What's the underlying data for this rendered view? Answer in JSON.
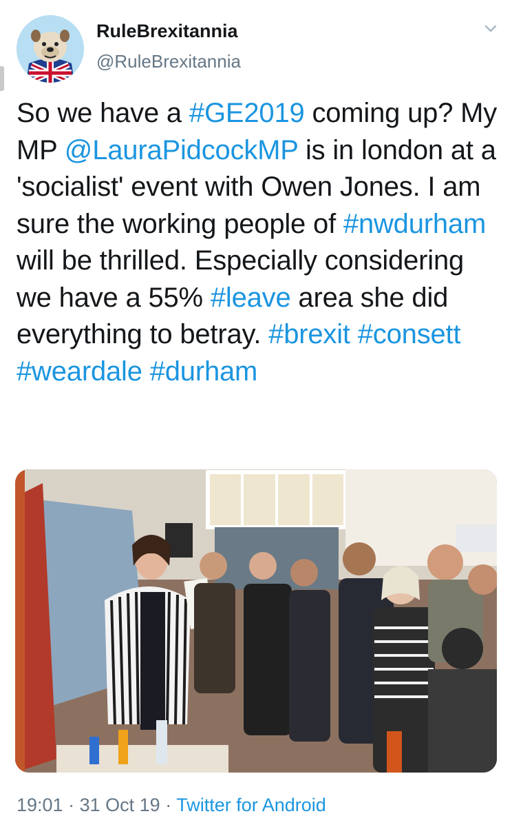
{
  "author": {
    "display_name": "RuleBrexitannia",
    "handle": "@RuleBrexitannia",
    "avatar_icon": "bulldog-union-jack-avatar"
  },
  "tweet": {
    "segments": [
      {
        "type": "text",
        "value": "So we have a "
      },
      {
        "type": "tag",
        "value": "#GE2019"
      },
      {
        "type": "text",
        "value": " coming up? My MP "
      },
      {
        "type": "mention",
        "value": "@LauraPidcockMP"
      },
      {
        "type": "text",
        "value": " is in london at a 'socialist' event with Owen Jones. I am sure the working people of "
      },
      {
        "type": "tag",
        "value": "#nwdurham"
      },
      {
        "type": "text",
        "value": " will be thrilled. Especially considering we have a 55% "
      },
      {
        "type": "tag",
        "value": "#leave"
      },
      {
        "type": "text",
        "value": " area she did everything to betray. "
      },
      {
        "type": "tag",
        "value": "#brexit"
      },
      {
        "type": "text",
        "value": " "
      },
      {
        "type": "tag",
        "value": "#consett"
      },
      {
        "type": "text",
        "value": " "
      },
      {
        "type": "tag",
        "value": "#weardale"
      },
      {
        "type": "text",
        "value": " "
      },
      {
        "type": "tag",
        "value": "#durham"
      }
    ]
  },
  "meta": {
    "time": "19:01",
    "separator": "·",
    "date": "31 Oct 19",
    "source": "Twitter for Android"
  },
  "icons": {
    "menu": "chevron-down-icon"
  },
  "colors": {
    "link": "#1b95e0",
    "secondary_text": "#657786",
    "primary_text": "#14171a"
  }
}
